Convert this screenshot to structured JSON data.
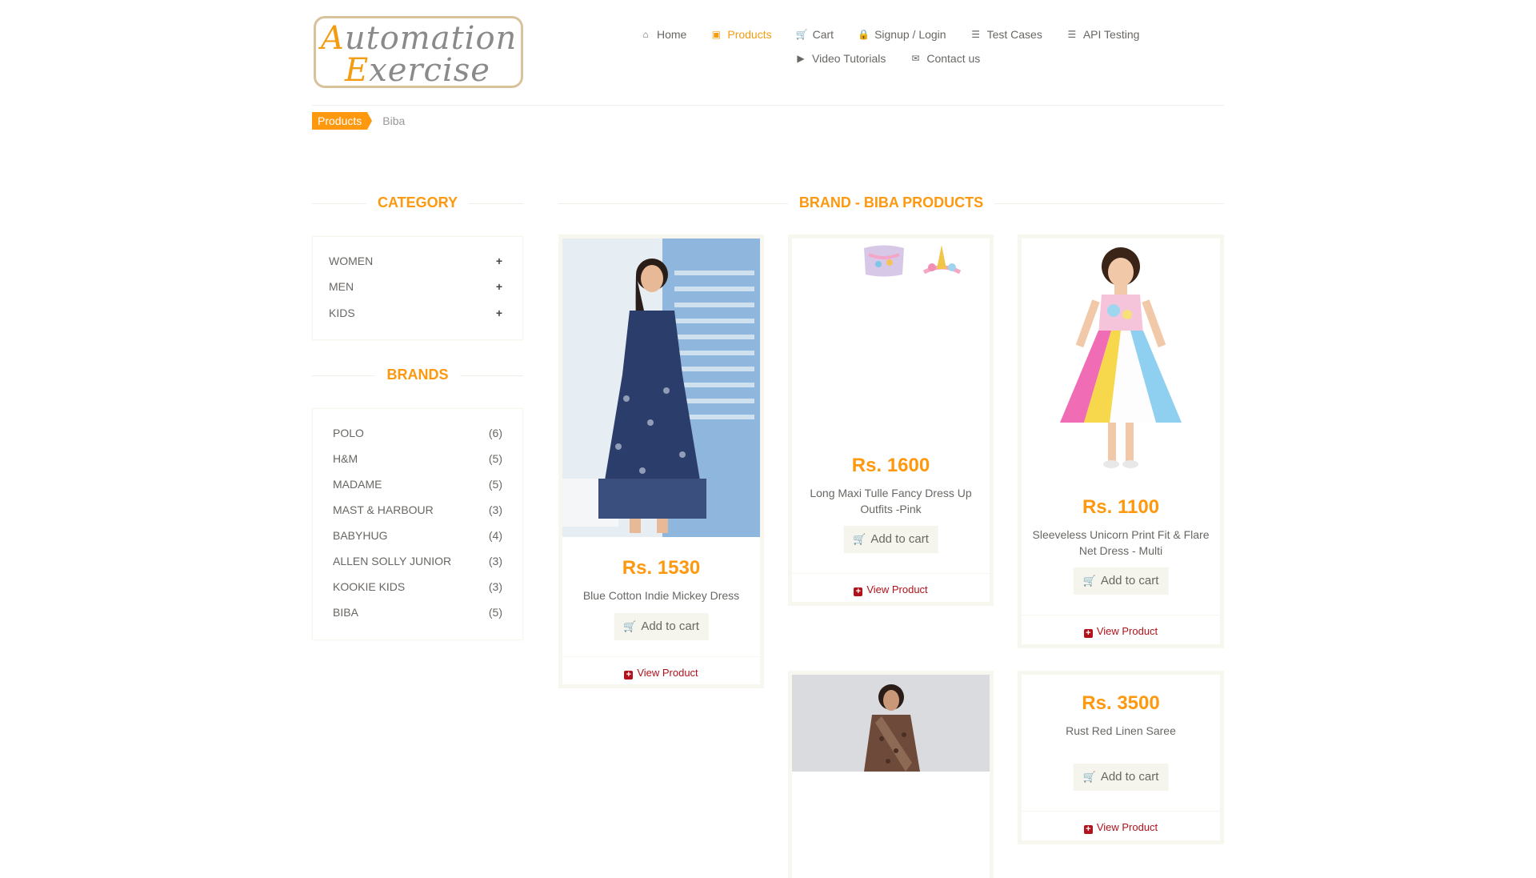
{
  "logo": {
    "line1_cap": "A",
    "line1_rest": "utomation",
    "line2_cap": "E",
    "line2_rest": "xercise"
  },
  "nav": {
    "items": [
      {
        "label": "Home",
        "icon": "home-icon"
      },
      {
        "label": "Products",
        "icon": "products-icon",
        "active": true
      },
      {
        "label": "Cart",
        "icon": "cart-icon"
      },
      {
        "label": "Signup / Login",
        "icon": "lock-icon"
      },
      {
        "label": "Test Cases",
        "icon": "list-icon"
      },
      {
        "label": "API Testing",
        "icon": "list-icon"
      },
      {
        "label": "Video Tutorials",
        "icon": "youtube-icon"
      },
      {
        "label": "Contact us",
        "icon": "envelope-icon"
      }
    ]
  },
  "breadcrumb": {
    "parent": "Products",
    "current": "Biba"
  },
  "sidebar": {
    "category_title": "Category",
    "categories": [
      "Women",
      "Men",
      "Kids"
    ],
    "brands_title": "Brands",
    "brands": [
      {
        "name": "POLO",
        "count": "(6)"
      },
      {
        "name": "H&M",
        "count": "(5)"
      },
      {
        "name": "MADAME",
        "count": "(5)"
      },
      {
        "name": "MAST & HARBOUR",
        "count": "(3)"
      },
      {
        "name": "BABYHUG",
        "count": "(4)"
      },
      {
        "name": "ALLEN SOLLY JUNIOR",
        "count": "(3)"
      },
      {
        "name": "KOOKIE KIDS",
        "count": "(3)"
      },
      {
        "name": "BIBA",
        "count": "(5)"
      }
    ]
  },
  "main": {
    "title": "Brand - Biba Products",
    "add_label": "Add to cart",
    "view_label": "View Product",
    "products": [
      {
        "price": "Rs. 1530",
        "name": "Blue Cotton Indie Mickey Dress"
      },
      {
        "price": "Rs. 1600",
        "name": "Long Maxi Tulle Fancy Dress Up Outfits -Pink"
      },
      {
        "price": "Rs. 1100",
        "name": "Sleeveless Unicorn Print Fit & Flare Net Dress - Multi"
      },
      {
        "price": "",
        "name": ""
      },
      {
        "price": "Rs. 3500",
        "name": "Rust Red Linen Saree"
      }
    ]
  },
  "colors": {
    "accent": "#fe980f",
    "view_link": "#b2121b",
    "button_bg": "#f5f5ed"
  }
}
